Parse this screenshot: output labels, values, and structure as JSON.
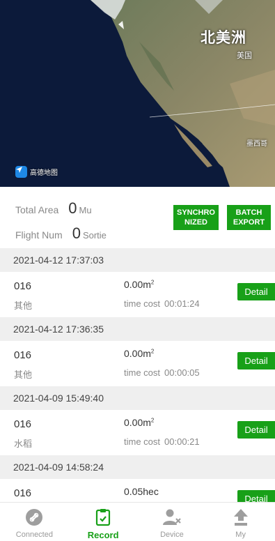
{
  "map": {
    "label_continent": "北美洲",
    "label_us": "美国",
    "label_mexico": "墨西哥",
    "logo_text": "高德地图"
  },
  "summary": {
    "total_area_label": "Total Area",
    "total_area_value": "0",
    "total_area_unit": "Mu",
    "flight_num_label": "Flight Num",
    "flight_num_value": "0",
    "flight_num_unit": "Sortie",
    "sync_button": "SYNCHRONIZED",
    "export_button": "BATCH EXPORT"
  },
  "records": [
    {
      "date": "2021-04-12 17:37:03",
      "id": "016",
      "crop": "其他",
      "area": "0.00m",
      "area_sup": "2",
      "time_cost_label": "time cost",
      "time_cost": "00:01:24",
      "detail": "Detail"
    },
    {
      "date": "2021-04-12 17:36:35",
      "id": "016",
      "crop": "其他",
      "area": "0.00m",
      "area_sup": "2",
      "time_cost_label": "time cost",
      "time_cost": "00:00:05",
      "detail": "Detail"
    },
    {
      "date": "2021-04-09 15:49:40",
      "id": "016",
      "crop": "水稻",
      "area": "0.00m",
      "area_sup": "2",
      "time_cost_label": "time cost",
      "time_cost": "00:00:21",
      "detail": "Detail"
    },
    {
      "date": "2021-04-09 14:58:24",
      "id": "016",
      "crop": "",
      "area": "0.05hec",
      "area_sup": "",
      "time_cost_label": "",
      "time_cost": "",
      "detail": "Detail"
    }
  ],
  "nav": [
    {
      "label": "Connected",
      "icon": "link-icon"
    },
    {
      "label": "Record",
      "icon": "clipboard-icon"
    },
    {
      "label": "Device",
      "icon": "device-user-icon"
    },
    {
      "label": "My",
      "icon": "upload-user-icon"
    }
  ],
  "colors": {
    "accent": "#18a018",
    "header_bg": "#efefef"
  }
}
